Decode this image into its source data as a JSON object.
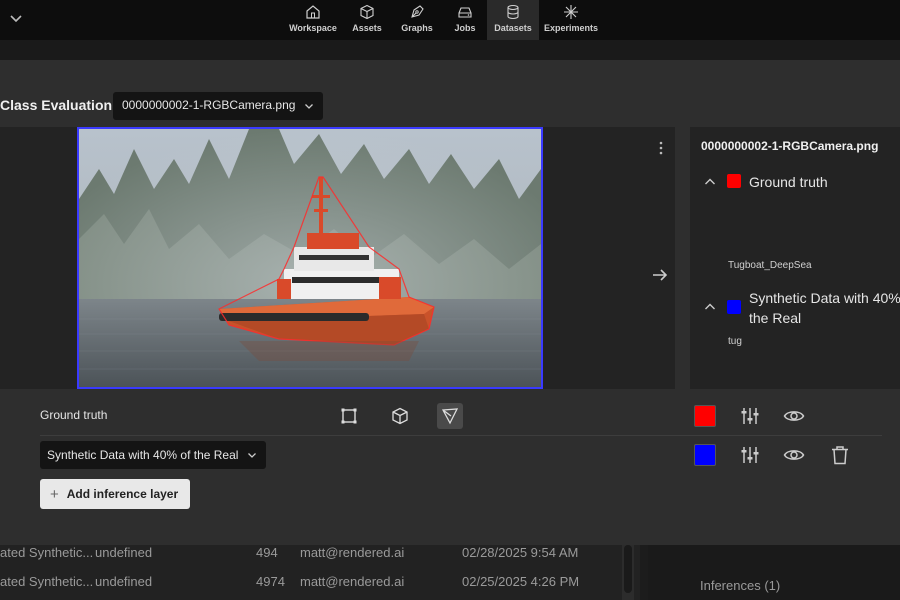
{
  "nav": {
    "items": [
      {
        "label": "Workspace",
        "icon": "home-icon"
      },
      {
        "label": "Assets",
        "icon": "cube-icon"
      },
      {
        "label": "Graphs",
        "icon": "pen-tool-icon"
      },
      {
        "label": "Jobs",
        "icon": "drive-icon"
      },
      {
        "label": "Datasets",
        "icon": "database-icon",
        "active": true
      },
      {
        "label": "Experiments",
        "icon": "sparkle-icon"
      }
    ]
  },
  "modal": {
    "title": "Class Evaluation",
    "file_select": "0000000002-1-RGBCamera.png"
  },
  "panel": {
    "file_name": "0000000002-1-RGBCamera.png",
    "layers": [
      {
        "name": "Ground truth",
        "color": "#ff0000",
        "class": "Tugboat_DeepSea"
      },
      {
        "name": "Synthetic Data with 40% of the Real",
        "color": "#0000ff",
        "class": "tug"
      }
    ]
  },
  "controls": {
    "ground_truth_label": "Ground truth",
    "ground_truth_color": "#ff0000",
    "model_select": "Synthetic Data with 40% of the Real",
    "model_color": "#0000ff",
    "add_layer_label": "Add inference layer"
  },
  "background": {
    "rows": [
      {
        "name": "ated Synthetic...",
        "desc": "undefined",
        "count": "494",
        "user": "matt@rendered.ai",
        "date": "02/28/2025 9:54 AM"
      },
      {
        "name": "ated Synthetic...",
        "desc": "undefined",
        "count": "4974",
        "user": "matt@rendered.ai",
        "date": "02/25/2025 4:26 PM"
      }
    ],
    "inferences_label": "Inferences (1)"
  }
}
